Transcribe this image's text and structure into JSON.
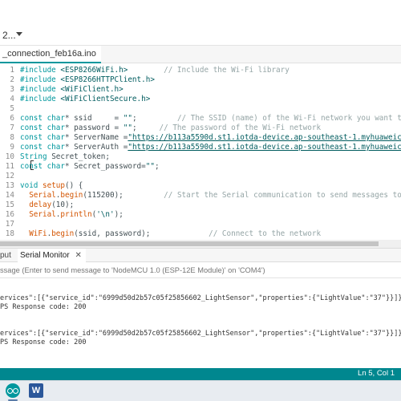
{
  "toolbar": {
    "board_select_label": "2..."
  },
  "editor": {
    "tab_label": "_connection_feb16a.ino",
    "cursor_position": "Ln 5, Col 1"
  },
  "code_lines": [
    {
      "n": "1",
      "parts": [
        {
          "t": "#include ",
          "c": "kw"
        },
        {
          "t": "<ESP8266WiFi.h>",
          "c": "str"
        },
        {
          "t": "        // Include the Wi-Fi library",
          "c": "cmt"
        }
      ]
    },
    {
      "n": "2",
      "parts": [
        {
          "t": "#include ",
          "c": "kw"
        },
        {
          "t": "<ESP8266HTTPClient.h>",
          "c": "str"
        }
      ]
    },
    {
      "n": "3",
      "parts": [
        {
          "t": "#include ",
          "c": "kw"
        },
        {
          "t": "<WiFiClient.h>",
          "c": "str"
        }
      ]
    },
    {
      "n": "4",
      "parts": [
        {
          "t": "#include ",
          "c": "kw"
        },
        {
          "t": "<WiFiClientSecure.h>",
          "c": "str"
        }
      ]
    },
    {
      "n": "5",
      "parts": []
    },
    {
      "n": "6",
      "parts": [
        {
          "t": "const char",
          "c": "kw"
        },
        {
          "t": "* ssid     = ",
          "c": ""
        },
        {
          "t": "\"\"",
          "c": "str"
        },
        {
          "t": ";         ",
          "c": ""
        },
        {
          "t": "// The SSID (name) of the Wi-Fi network you want to connect",
          "c": "cmt"
        }
      ]
    },
    {
      "n": "7",
      "parts": [
        {
          "t": "const char",
          "c": "kw"
        },
        {
          "t": "* password = ",
          "c": ""
        },
        {
          "t": "\"\"",
          "c": "str"
        },
        {
          "t": ";     ",
          "c": ""
        },
        {
          "t": "// The password of the Wi-Fi network",
          "c": "cmt"
        }
      ]
    },
    {
      "n": "8",
      "parts": [
        {
          "t": "const char",
          "c": "kw"
        },
        {
          "t": "* ServerName =",
          "c": ""
        },
        {
          "t": "\"https://b113a5590d.st1.iotda-device.ap-southeast-1.myhuaweicloud.com/v",
          "c": "url"
        }
      ]
    },
    {
      "n": "9",
      "parts": [
        {
          "t": "const char",
          "c": "kw"
        },
        {
          "t": "* ServerAuth =",
          "c": ""
        },
        {
          "t": "\"https://b113a5590d.st1.iotda-device.ap-southeast-1.myhuaweicloud.com/v",
          "c": "url"
        }
      ]
    },
    {
      "n": "10",
      "parts": [
        {
          "t": "String",
          "c": "kw"
        },
        {
          "t": " Secret_token;",
          "c": ""
        }
      ]
    },
    {
      "n": "11",
      "parts": [
        {
          "t": "const char",
          "c": "kw"
        },
        {
          "t": "* Secret_password=",
          "c": ""
        },
        {
          "t": "\"\"",
          "c": "str"
        },
        {
          "t": ";",
          "c": ""
        }
      ]
    },
    {
      "n": "12",
      "parts": []
    },
    {
      "n": "13",
      "parts": [
        {
          "t": "void",
          "c": "kw"
        },
        {
          "t": " ",
          "c": ""
        },
        {
          "t": "setup",
          "c": "fn"
        },
        {
          "t": "() {",
          "c": ""
        }
      ]
    },
    {
      "n": "14",
      "parts": [
        {
          "t": "  ",
          "c": ""
        },
        {
          "t": "Serial",
          "c": "fn"
        },
        {
          "t": ".",
          "c": ""
        },
        {
          "t": "begin",
          "c": "fn"
        },
        {
          "t": "(115200);         ",
          "c": ""
        },
        {
          "t": "// Start the Serial communication to send messages to the compu",
          "c": "cmt"
        }
      ]
    },
    {
      "n": "15",
      "parts": [
        {
          "t": "  ",
          "c": ""
        },
        {
          "t": "delay",
          "c": "fn"
        },
        {
          "t": "(10);",
          "c": ""
        }
      ]
    },
    {
      "n": "16",
      "parts": [
        {
          "t": "  ",
          "c": ""
        },
        {
          "t": "Serial",
          "c": "fn"
        },
        {
          "t": ".",
          "c": ""
        },
        {
          "t": "println",
          "c": "fn"
        },
        {
          "t": "(",
          "c": ""
        },
        {
          "t": "'\\n'",
          "c": "str"
        },
        {
          "t": ");",
          "c": ""
        }
      ]
    },
    {
      "n": "17",
      "parts": []
    },
    {
      "n": "18",
      "parts": [
        {
          "t": "  ",
          "c": ""
        },
        {
          "t": "WiFi",
          "c": "fn"
        },
        {
          "t": ".",
          "c": ""
        },
        {
          "t": "begin",
          "c": "fn"
        },
        {
          "t": "(ssid, password);             ",
          "c": ""
        },
        {
          "t": "// Connect to the network",
          "c": "cmt"
        }
      ]
    }
  ],
  "bottom_panel": {
    "tabs": [
      "put",
      "Serial Monitor"
    ],
    "close_glyph": "✕",
    "message_placeholder": "ssage (Enter to send message to 'NodeMCU 1.0 (ESP-12E Module)' on 'COM4')"
  },
  "serial_lines": [
    "ervices\":[{\"service_id\":\"6999d50d2b57c05f25856602_LightSensor\",\"properties\":{\"LightValue\":\"37\"}}]}",
    "PS Response code: 200",
    "",
    "",
    "ervices\":[{\"service_id\":\"6999d50d2b57c05f25856602_LightSensor\",\"properties\":{\"LightValue\":\"37\"}}]}",
    "PS Response code: 200"
  ],
  "taskbar": {
    "word_letter": "W"
  },
  "colors": {
    "accent": "#00979d",
    "statusbar": "#00878f",
    "keyword": "#00979d",
    "function": "#d35400",
    "comment": "#95a5a6"
  }
}
